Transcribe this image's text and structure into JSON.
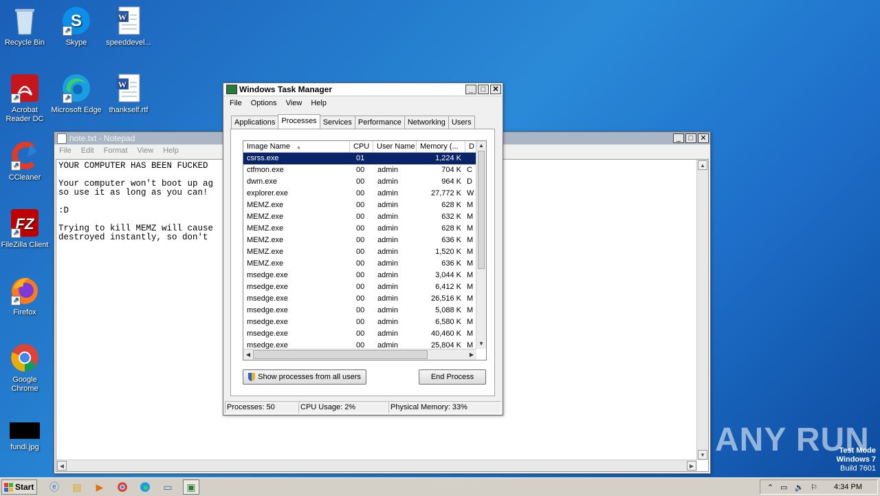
{
  "desktop": {
    "icons": [
      {
        "label": "Recycle Bin",
        "icon": "recycle-bin-icon"
      },
      {
        "label": "Skype",
        "icon": "skype-icon"
      },
      {
        "label": "speeddevel...",
        "icon": "word-document-icon"
      },
      {
        "label": "Acrobat Reader DC",
        "icon": "acrobat-icon"
      },
      {
        "label": "Microsoft Edge",
        "icon": "edge-icon"
      },
      {
        "label": "thankself.rtf",
        "icon": "word-document-icon"
      },
      {
        "label": "CCleaner",
        "icon": "ccleaner-icon"
      },
      {
        "label": "FileZilla Client",
        "icon": "filezilla-icon"
      },
      {
        "label": "Firefox",
        "icon": "firefox-icon"
      },
      {
        "label": "Google Chrome",
        "icon": "chrome-icon"
      },
      {
        "label": "fundi.jpg",
        "icon": "image-file-icon"
      }
    ],
    "watermark": {
      "line1": "Test Mode",
      "line2": "Windows 7",
      "line3": "Build 7601"
    },
    "anyrun": "ANY RUN"
  },
  "notepad": {
    "title": "note.txt - Notepad",
    "menu": [
      "File",
      "Edit",
      "Format",
      "View",
      "Help"
    ],
    "text": "YOUR COMPUTER HAS BEEN FUCKED\n\nYour computer won't boot up ag\nso use it as long as you can!\n\n:D\n\nTrying to kill MEMZ will cause\ndestroyed instantly, so don't "
  },
  "taskmgr": {
    "title": "Windows Task Manager",
    "menu": [
      "File",
      "Options",
      "View",
      "Help"
    ],
    "tabs": [
      "Applications",
      "Processes",
      "Services",
      "Performance",
      "Networking",
      "Users"
    ],
    "active_tab": "Processes",
    "columns": {
      "name": "Image Name",
      "cpu": "CPU",
      "user": "User Name",
      "mem": "Memory (...",
      "desc": "D"
    },
    "rows": [
      {
        "name": "csrss.exe",
        "cpu": "01",
        "user": "",
        "mem": "1,224 K",
        "desc": ""
      },
      {
        "name": "ctfmon.exe",
        "cpu": "00",
        "user": "admin",
        "mem": "704 K",
        "desc": "C"
      },
      {
        "name": "dwm.exe",
        "cpu": "00",
        "user": "admin",
        "mem": "964 K",
        "desc": "D"
      },
      {
        "name": "explorer.exe",
        "cpu": "00",
        "user": "admin",
        "mem": "27,772 K",
        "desc": "W"
      },
      {
        "name": "MEMZ.exe",
        "cpu": "00",
        "user": "admin",
        "mem": "628 K",
        "desc": "M"
      },
      {
        "name": "MEMZ.exe",
        "cpu": "00",
        "user": "admin",
        "mem": "632 K",
        "desc": "M"
      },
      {
        "name": "MEMZ.exe",
        "cpu": "00",
        "user": "admin",
        "mem": "628 K",
        "desc": "M"
      },
      {
        "name": "MEMZ.exe",
        "cpu": "00",
        "user": "admin",
        "mem": "636 K",
        "desc": "M"
      },
      {
        "name": "MEMZ.exe",
        "cpu": "00",
        "user": "admin",
        "mem": "1,520 K",
        "desc": "M"
      },
      {
        "name": "MEMZ.exe",
        "cpu": "00",
        "user": "admin",
        "mem": "636 K",
        "desc": "M"
      },
      {
        "name": "msedge.exe",
        "cpu": "00",
        "user": "admin",
        "mem": "3,044 K",
        "desc": "M"
      },
      {
        "name": "msedge.exe",
        "cpu": "00",
        "user": "admin",
        "mem": "6,412 K",
        "desc": "M"
      },
      {
        "name": "msedge.exe",
        "cpu": "00",
        "user": "admin",
        "mem": "26,516 K",
        "desc": "M"
      },
      {
        "name": "msedge.exe",
        "cpu": "00",
        "user": "admin",
        "mem": "5,088 K",
        "desc": "M"
      },
      {
        "name": "msedge.exe",
        "cpu": "00",
        "user": "admin",
        "mem": "6,580 K",
        "desc": "M"
      },
      {
        "name": "msedge.exe",
        "cpu": "00",
        "user": "admin",
        "mem": "40,460 K",
        "desc": "M"
      },
      {
        "name": "msedge.exe",
        "cpu": "00",
        "user": "admin",
        "mem": "25,804 K",
        "desc": "M"
      }
    ],
    "show_all_label": "Show processes from all users",
    "end_process_label": "End Process",
    "status": {
      "processes": "Processes: 50",
      "cpu": "CPU Usage: 2%",
      "memory": "Physical Memory: 33%"
    }
  },
  "taskbar": {
    "start_label": "Start",
    "clock": "4:34 PM"
  },
  "colors": {
    "selection": "#0a246a",
    "desktop": "#1e6fc9"
  }
}
